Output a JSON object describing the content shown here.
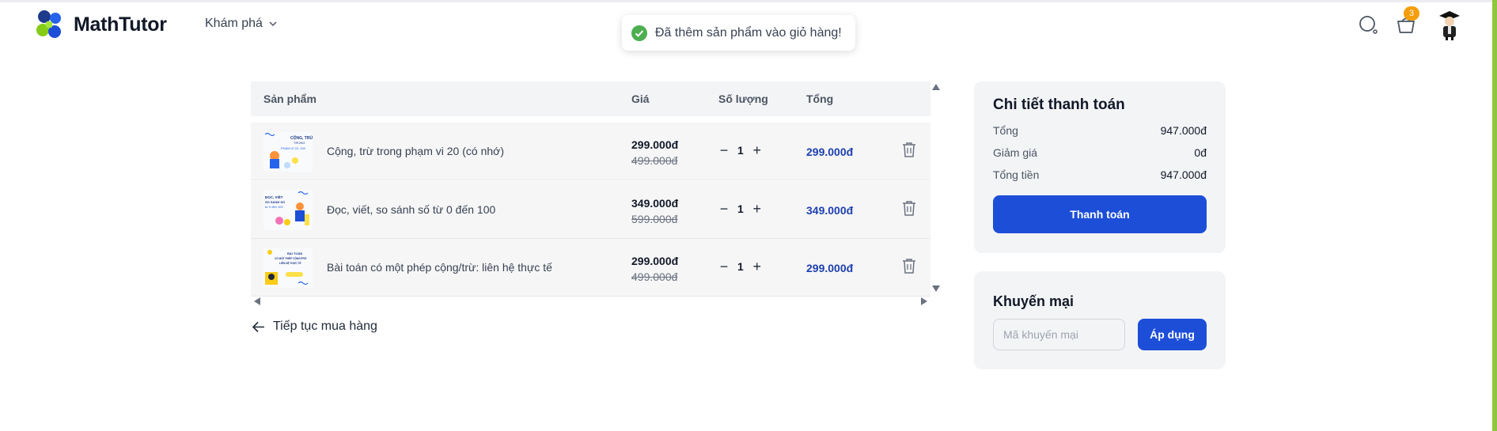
{
  "header": {
    "brand": "MathTutor",
    "nav_explore": "Khám phá",
    "cart_count": "3",
    "icons": {
      "search": "search-icon",
      "cart": "basket-icon",
      "avatar": "graduate-avatar"
    }
  },
  "toast": {
    "message": "Đã thêm sản phẩm vào giỏ hàng!",
    "icon": "check-circle-icon",
    "color": "#4caf50"
  },
  "cart": {
    "columns": {
      "product": "Sản phẩm",
      "price": "Giá",
      "quantity": "Số lượng",
      "total": "Tổng"
    },
    "items": [
      {
        "name": "Cộng, trừ trong phạm vi 20 (có nhớ)",
        "price": "299.000đ",
        "old_price": "499.000đ",
        "quantity": "1",
        "total": "299.000đ",
        "thumb": {
          "l1": "CỘNG, TRỪ",
          "l2": "TRONG",
          "l3": "PHẠM VI 20, 100"
        }
      },
      {
        "name": "Đọc, viết, so sánh số từ 0 đến 100",
        "price": "349.000đ",
        "old_price": "599.000đ",
        "quantity": "1",
        "total": "349.000đ",
        "thumb": {
          "l1": "ĐỌC, VIẾT",
          "l2": "SO SÁNH SỐ",
          "l3": "từ 0 đến 100"
        }
      },
      {
        "name": "Bài toán có một phép cộng/trừ: liên hệ thực tế",
        "price": "299.000đ",
        "old_price": "499.000đ",
        "quantity": "1",
        "total": "299.000đ",
        "thumb": {
          "l1": "BÀI TOÁN",
          "l2": "CÓ MỘT PHÉP CỘNG/TRỪ",
          "l3": "LIÊN HỆ THỰC TẾ"
        }
      }
    ],
    "continue_label": "Tiếp tục mua hàng"
  },
  "summary": {
    "title": "Chi tiết thanh toán",
    "subtotal_label": "Tổng",
    "subtotal": "947.000đ",
    "discount_label": "Giảm giá",
    "discount": "0đ",
    "grand_total_label": "Tổng tiền",
    "grand_total": "947.000đ",
    "pay_label": "Thanh toán"
  },
  "promo": {
    "title": "Khuyến mại",
    "placeholder": "Mã khuyến mại",
    "value": "",
    "apply_label": "Áp dụng"
  },
  "colors": {
    "primary": "#1d4ed8",
    "total_text": "#1e40af",
    "badge": "#f59e0b",
    "accent_stripe": "#8ec73d"
  }
}
